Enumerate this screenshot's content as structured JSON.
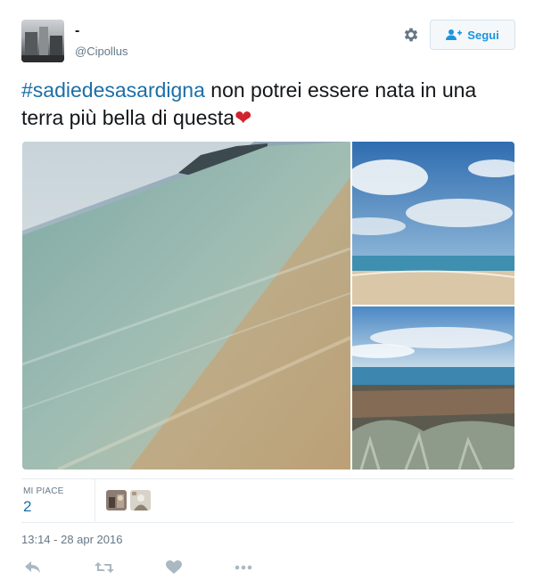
{
  "user": {
    "name": "-",
    "handle": "@Cipollus"
  },
  "follow_button": {
    "label": "Segui"
  },
  "tweet": {
    "hashtag": "#sadiedesasardigna",
    "text": " non potrei essere nata in una terra più bella di questa",
    "emoji": "❤"
  },
  "stats": {
    "likes_label": "MI PIACE",
    "likes_count": "2"
  },
  "timestamp": "13:14 - 28 apr 2016",
  "colors": {
    "link": "#1b6fa8",
    "muted": "#657786",
    "follow_text": "#1b95e0",
    "heart": "#d2222d"
  },
  "icons": [
    "gear-icon",
    "add-user-icon",
    "reply-icon",
    "retweet-icon",
    "like-icon",
    "more-icon"
  ]
}
